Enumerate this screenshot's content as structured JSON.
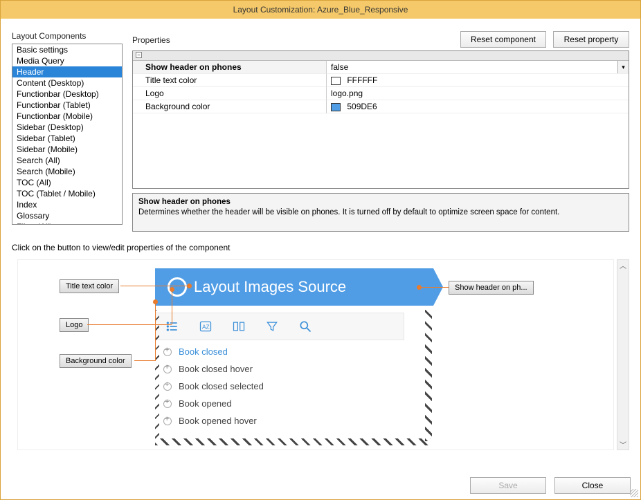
{
  "window": {
    "title": "Layout Customization: Azure_Blue_Responsive"
  },
  "labels": {
    "components": "Layout Components",
    "properties": "Properties",
    "hint": "Click on the button to view/edit properties of the component"
  },
  "buttons": {
    "reset_component": "Reset component",
    "reset_property": "Reset property",
    "save": "Save",
    "close": "Close"
  },
  "components": {
    "selected_index": 2,
    "items": [
      "Basic settings",
      "Media Query",
      "Header",
      "Content (Desktop)",
      "Functionbar (Desktop)",
      "Functionbar (Tablet)",
      "Functionbar (Mobile)",
      "Sidebar (Desktop)",
      "Sidebar (Tablet)",
      "Sidebar (Mobile)",
      "Search (All)",
      "Search (Mobile)",
      "TOC (All)",
      "TOC (Tablet / Mobile)",
      "Index",
      "Glossary",
      "Filter (All)"
    ]
  },
  "props": {
    "show_header_phones": {
      "name": "Show header on phones",
      "value": "false"
    },
    "title_color": {
      "name": "Title text color",
      "value": "FFFFFF",
      "swatch": "#FFFFFF"
    },
    "logo": {
      "name": "Logo",
      "value": "logo.png"
    },
    "bg_color": {
      "name": "Background color",
      "value": "509DE6",
      "swatch": "#509DE6"
    }
  },
  "description": {
    "title": "Show header on phones",
    "body": "Determines whether the header will be visible on phones. It is turned off by default to optimize screen space for content."
  },
  "callouts": {
    "title_color": "Title text color",
    "logo": "Logo",
    "bg_color": "Background color",
    "show_header": "Show header on ph..."
  },
  "preview": {
    "banner_text": "Layout Images Source",
    "toc": [
      "Book closed",
      "Book closed hover",
      "Book closed selected",
      "Book opened",
      "Book opened hover"
    ]
  }
}
